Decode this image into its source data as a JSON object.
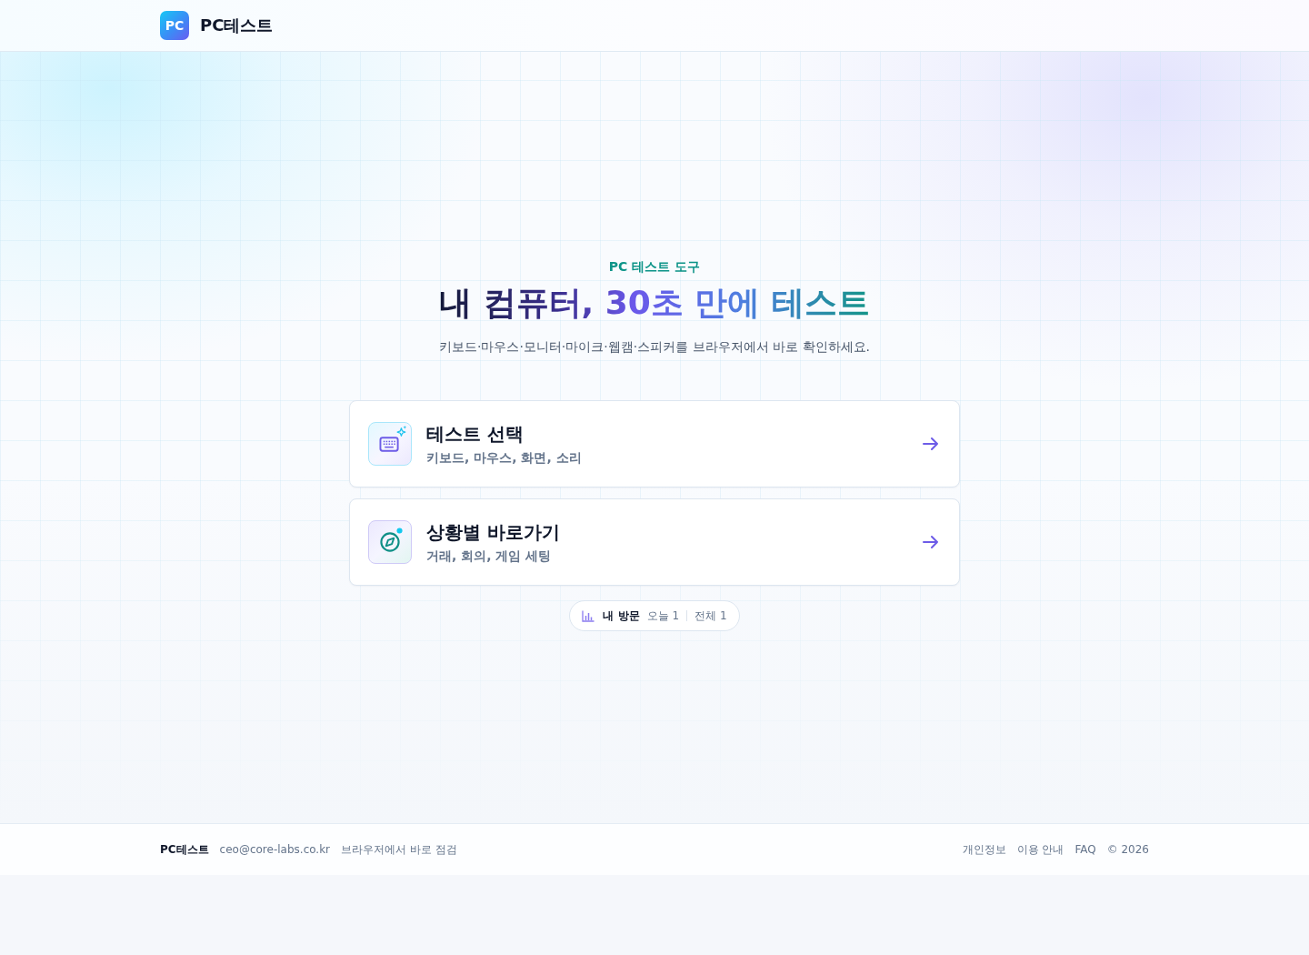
{
  "header": {
    "logo": "PC",
    "brand": "PC테스트"
  },
  "hero": {
    "eyebrow": "PC 테스트 도구",
    "title": "내 컴퓨터, 30초 만에 테스트",
    "subtitle": "키보드·마우스·모니터·마이크·웹캠·스피커를 브라우저에서 바로 확인하세요."
  },
  "cards": [
    {
      "kind": "keyboard",
      "title": "테스트 선택",
      "subtitle": "키보드, 마우스, 화면, 소리"
    },
    {
      "kind": "compass",
      "title": "상황별 바로가기",
      "subtitle": "거래, 회의, 게임 세팅"
    }
  ],
  "visits": {
    "label": "내 방문",
    "today": "오늘 1",
    "total": "전체 1"
  },
  "footer": {
    "brand": "PC테스트",
    "email": "ceo@core-labs.co.kr",
    "tagline": "브라우저에서 바로 점검",
    "links": [
      "개인정보",
      "이용 안내",
      "FAQ"
    ],
    "copyright": "© 2026"
  }
}
